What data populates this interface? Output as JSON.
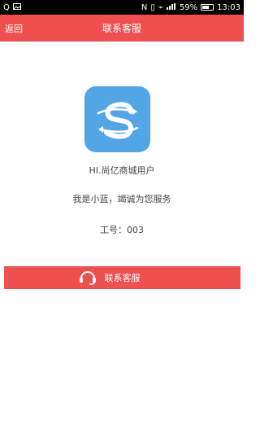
{
  "status_bar": {
    "left_icons": [
      "search-icon",
      "image-icon"
    ],
    "battery_percent": "59%",
    "time": "13:03",
    "signal_icons": [
      "nfc-icon",
      "vibrate-icon",
      "wifi-icon",
      "signal-icon",
      "battery-icon"
    ]
  },
  "nav": {
    "back_label": "返回",
    "title": "联系客服"
  },
  "profile": {
    "app_user_label": "HI.尚亿商城用户",
    "intro": "我是小蓝，竭诚为您服务",
    "staff_id": "工号：003"
  },
  "cta": {
    "label": "联系客服",
    "icon": "headset-icon",
    "color": "#ef4f4f"
  },
  "colors": {
    "primary": "#ef4f4f",
    "logo_bg": "#53a6e6"
  }
}
